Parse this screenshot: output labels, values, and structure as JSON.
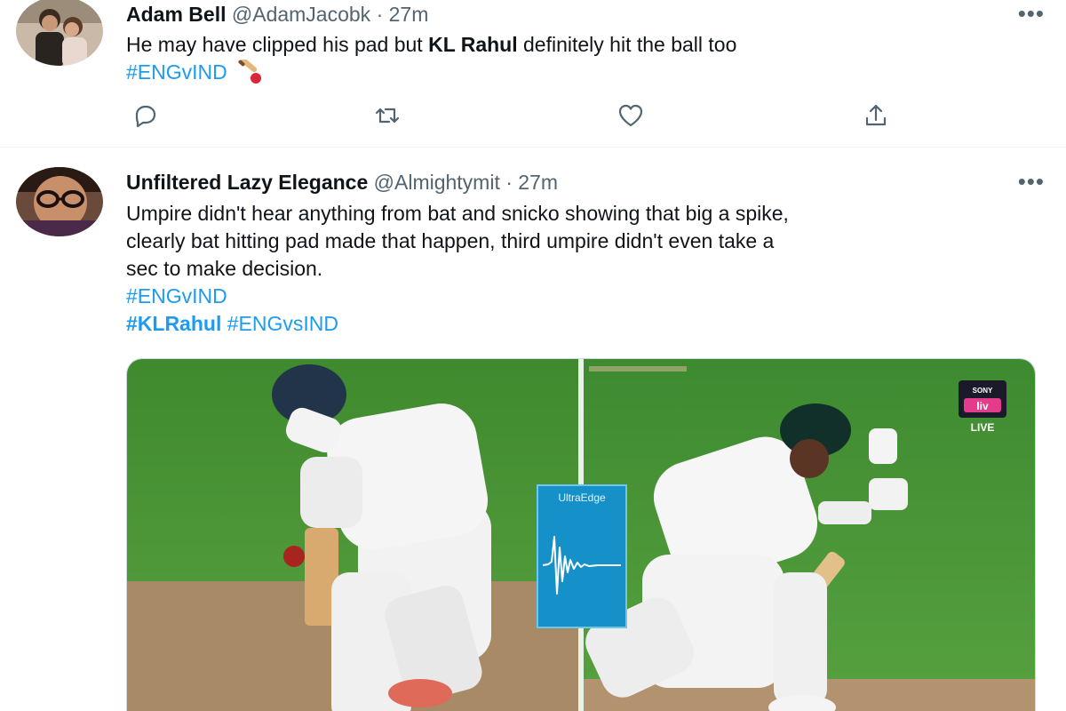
{
  "tweets": [
    {
      "name": "Adam Bell",
      "handle": "@AdamJacobk",
      "separator": "·",
      "time": "27m",
      "text_parts": {
        "pre": "He may have clipped his pad but ",
        "bold": "KL Rahul",
        "post": " definitely hit the ball too"
      },
      "hashtag": "#ENGvIND",
      "emoji": "cricket-bat-and-ball-emoji"
    },
    {
      "name": "Unfiltered Lazy Elegance",
      "handle": "@Almightymit",
      "separator": "·",
      "time": "27m",
      "lines": [
        "Umpire didn't hear anything from bat and snicko showing that big a spike,",
        "clearly bat hitting pad made that happen, third umpire didn't even take a",
        "sec to make decision."
      ],
      "hashtag_line1": "#ENGvIND",
      "hashtag_bold": "#KLRahul",
      "hashtag_plain": "#ENGvsIND",
      "media": {
        "overlay_label": "UltraEdge",
        "broadcaster_top": "SONY",
        "broadcaster_mid": "liv",
        "broadcaster_live": "LIVE"
      }
    }
  ],
  "icons": {
    "more": "more-dots-icon",
    "reply": "reply-icon",
    "retweet": "retweet-icon",
    "like": "like-icon",
    "share": "share-icon"
  },
  "colors": {
    "link": "#1d9bf0",
    "secondary_text": "#536471",
    "pitch_green": "#4f9a3a",
    "ultraedge_blue": "#1590c8"
  }
}
